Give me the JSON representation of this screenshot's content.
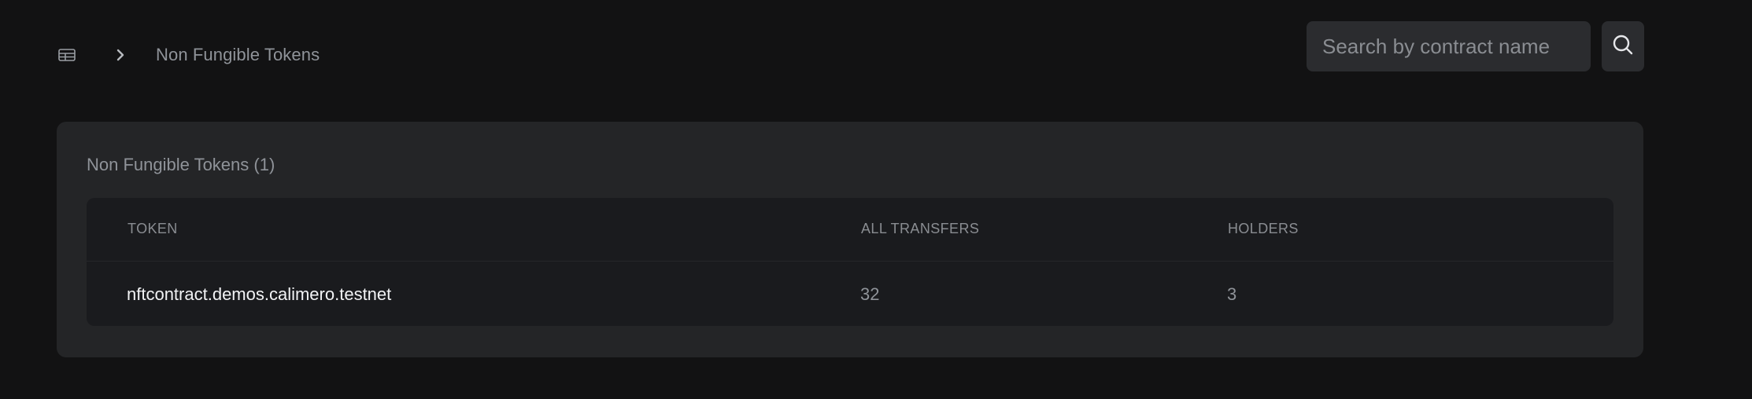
{
  "breadcrumb": {
    "home_icon": "table-icon",
    "separator_icon": "chevron-right-icon",
    "current": "Non Fungible Tokens"
  },
  "search": {
    "placeholder": "Search by contract name",
    "value": "",
    "button_icon": "search-icon"
  },
  "card": {
    "title": "Non Fungible Tokens (1)"
  },
  "table": {
    "headers": {
      "token": "TOKEN",
      "transfers": "ALL TRANSFERS",
      "holders": "HOLDERS"
    },
    "rows": [
      {
        "token": "nftcontract.demos.calimero.testnet",
        "transfers": "32",
        "holders": "3"
      }
    ]
  },
  "colors": {
    "page_bg": "#121213",
    "card_bg": "#242527",
    "table_bg": "#1a1b1e",
    "input_bg": "#2b2c2f",
    "muted_text": "#8f9399",
    "primary_text": "#f2f3f5"
  }
}
